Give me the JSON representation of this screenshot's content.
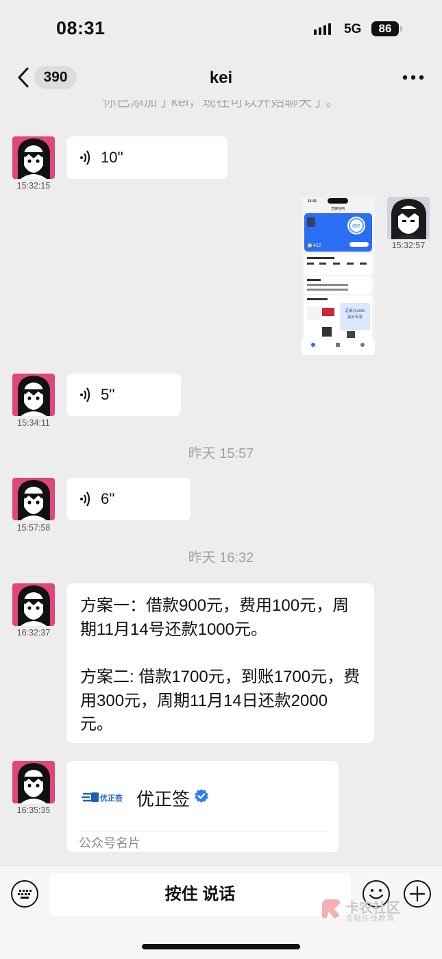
{
  "status_bar": {
    "time": "08:31",
    "network": "5G",
    "battery": "86"
  },
  "nav": {
    "unread_count": "390",
    "title": "kei"
  },
  "system_notice": "你已添加了kei，现在可以开始聊天了。",
  "messages": [
    {
      "type": "voice",
      "duration": "10''",
      "time": "15:32:15"
    },
    {
      "type": "image",
      "time": "15:32:57"
    },
    {
      "type": "voice",
      "duration": "5''",
      "time": "15:34:11"
    },
    {
      "type": "voice",
      "duration": "6''",
      "time": "15:57:58"
    },
    {
      "type": "text",
      "time": "16:32:37",
      "paragraphs": [
        "方案一：借款900元，费用100元，周期11月14号还款1000元。",
        "方案二: 借款1700元，到账1700元，费用300元，周期11月14日还款2000元。"
      ]
    },
    {
      "type": "card",
      "time": "16:35:35",
      "name": "优正签",
      "logo_text": "优正签",
      "card_type": "公众号名片"
    }
  ],
  "day_timestamps": [
    "昨天 15:57",
    "昨天 16:32"
  ],
  "screenshot": {
    "header": "芝麻信用",
    "score": "692",
    "score_small": "412",
    "status_time": "15:32",
    "banner_text": "芝麻分≥650",
    "banner_sub": "高分专享"
  },
  "bottom_bar": {
    "hold_to_talk": "按住 说话"
  },
  "watermark": {
    "title": "卡农社区",
    "subtitle": "金融在线教育"
  },
  "colors": {
    "background": "#ededed",
    "bubble": "#ffffff",
    "verified": "#2f7cf6",
    "accent_pink": "#e0457b"
  }
}
